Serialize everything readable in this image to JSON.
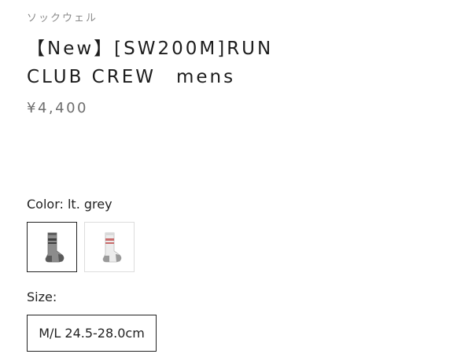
{
  "product": {
    "vendor": "ソックウェル",
    "title_line1": "【New】[SW200M]RUN",
    "title_line2": "CLUB CREW　mens",
    "price": "¥4,400"
  },
  "color": {
    "label": "Color: lt. grey",
    "swatches": [
      {
        "name": "lt. grey",
        "icon": "sock-grey-icon",
        "selected": true,
        "sock_color": "#8c8c8c",
        "stripe_color": "#4a4a4a"
      },
      {
        "name": "white",
        "icon": "sock-white-icon",
        "selected": false,
        "sock_color": "#e6e6e6",
        "stripe_color": "#c96b6b"
      }
    ]
  },
  "size": {
    "label": "Size:",
    "options": [
      {
        "label": "M/L 24.5-28.0cm",
        "selected": true
      }
    ]
  }
}
